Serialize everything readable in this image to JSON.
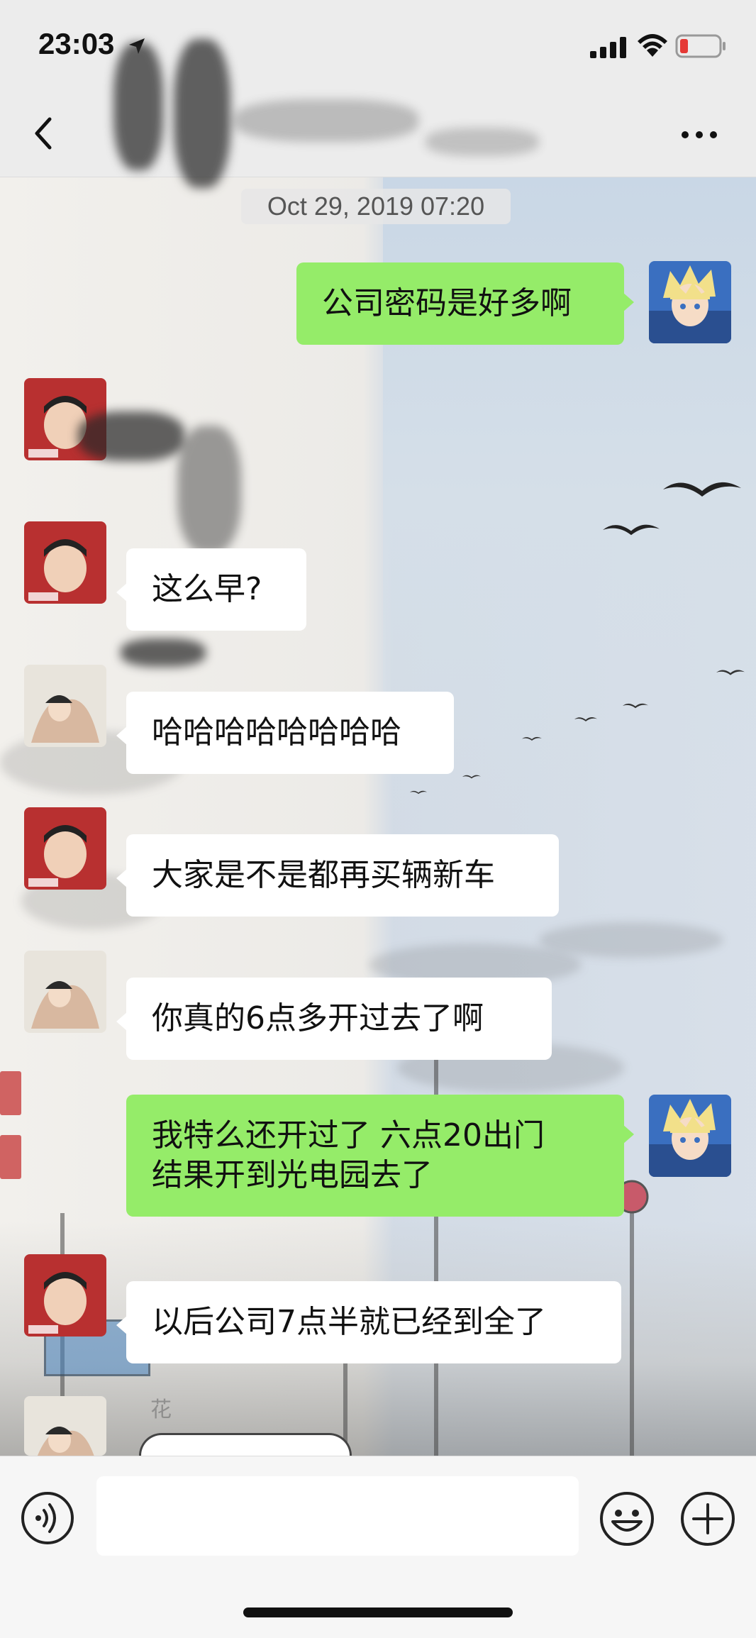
{
  "status_bar": {
    "time": "23:03",
    "icons": [
      "location-arrow-icon",
      "signal-icon",
      "wifi-icon",
      "battery-low-icon"
    ],
    "battery_color": "#e53935"
  },
  "nav": {
    "title": "",
    "back_icon": "chevron-left-icon",
    "more_icon": "more-dots-icon"
  },
  "chat": {
    "timestamp": "Oct 29, 2019 07:20",
    "sent_bubble_color": "#95ec69",
    "received_bubble_color": "#ffffff",
    "messages": [
      {
        "from": "me",
        "text": "公司密码是好多啊"
      },
      {
        "from": "contact-a",
        "text": ""
      },
      {
        "from": "contact-a",
        "text": "这么早?"
      },
      {
        "from": "contact-b",
        "text": "哈哈哈哈哈哈哈哈"
      },
      {
        "from": "contact-a",
        "text": "大家是不是都再买辆新车"
      },
      {
        "from": "contact-b",
        "text": "你真的6点多开过去了啊"
      },
      {
        "from": "me",
        "text": "我特么还开过了 六点20出门\n结果开到光电园去了"
      },
      {
        "from": "contact-a",
        "text": "以后公司7点半就已经到全了"
      },
      {
        "from": "contact-b",
        "text": ""
      }
    ],
    "sender_names": {
      "contact-b_last": "花"
    }
  },
  "input_bar": {
    "placeholder": "",
    "voice_icon": "voice-icon",
    "emoji_icon": "emoji-icon",
    "plus_icon": "plus-icon"
  }
}
